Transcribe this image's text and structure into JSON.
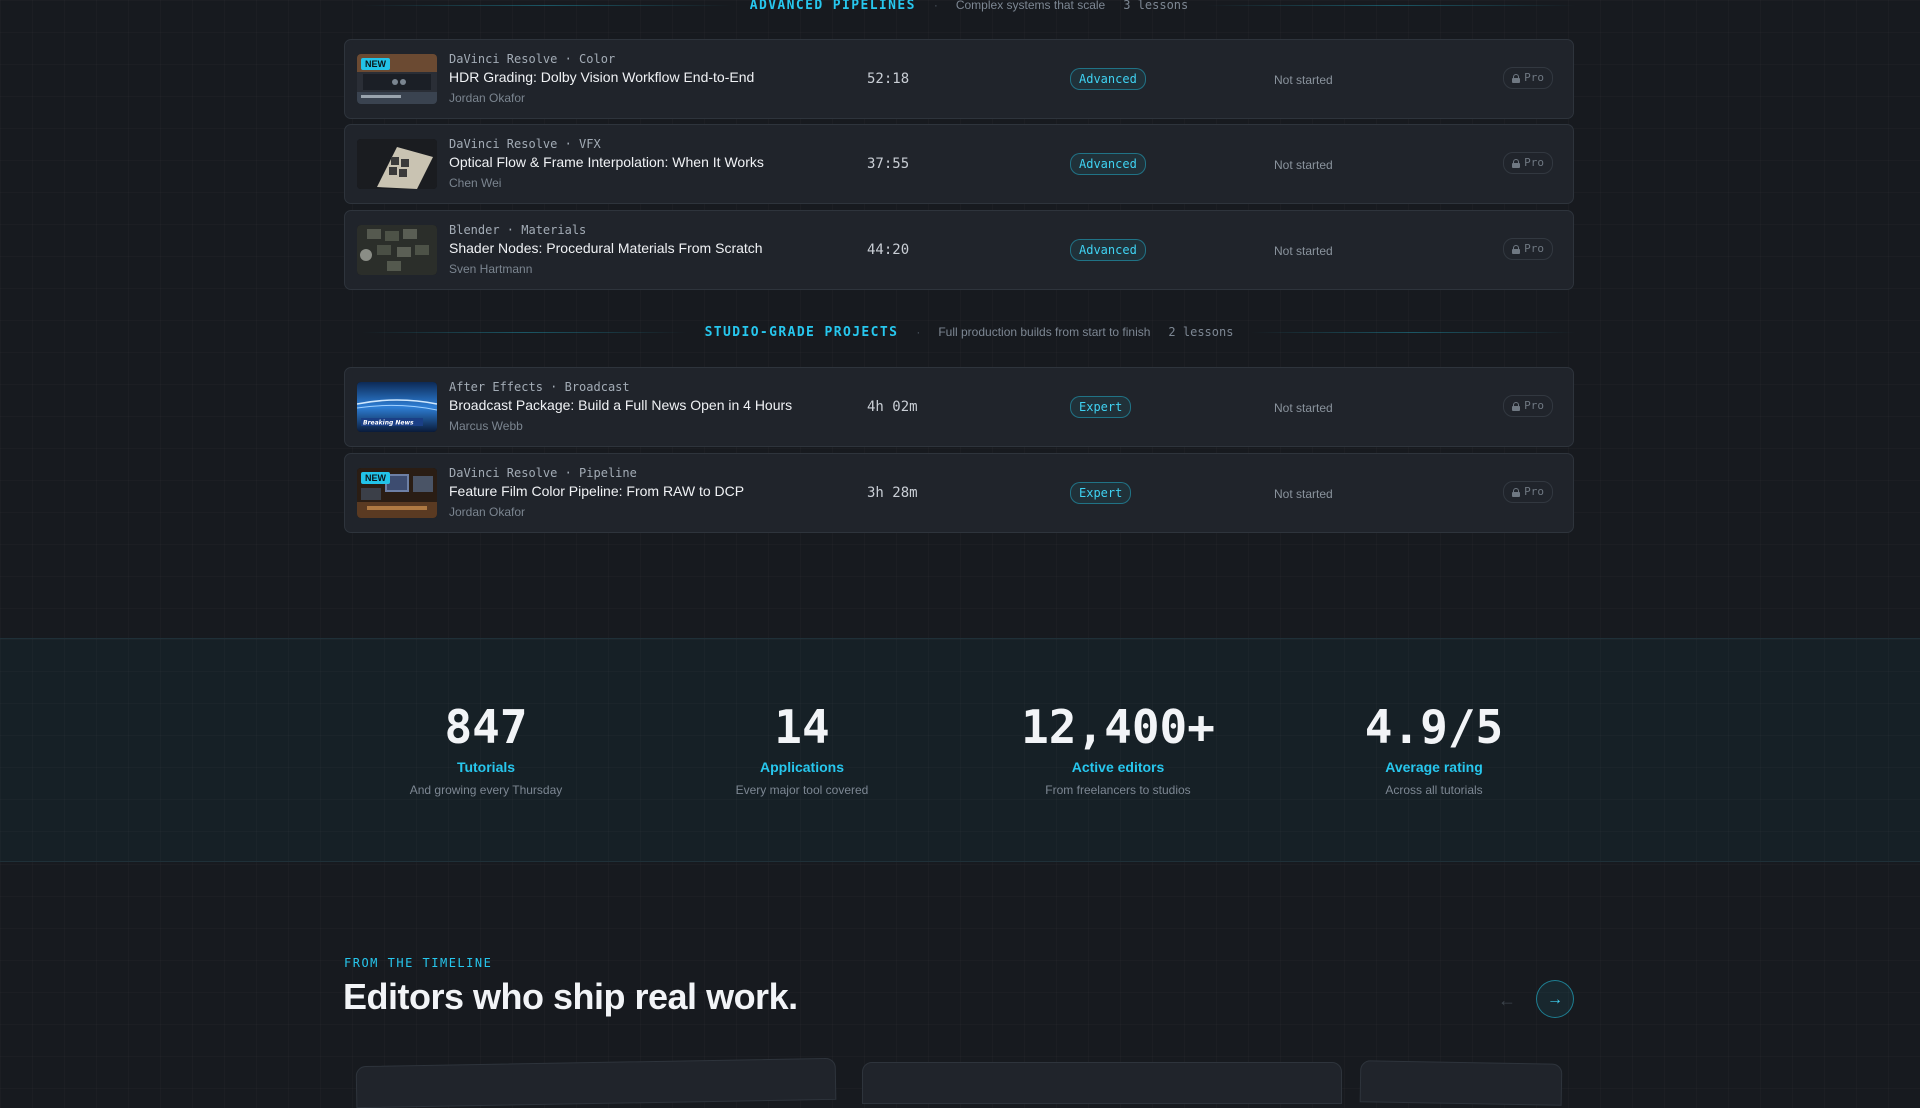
{
  "sections": [
    {
      "title": "ADVANCED PIPELINES",
      "subtitle": "Complex systems that scale",
      "count": "3 lessons"
    },
    {
      "title": "STUDIO-GRADE PROJECTS",
      "subtitle": "Full production builds from start to finish",
      "count": "2 lessons"
    }
  ],
  "separator": "·",
  "lessons": [
    {
      "meta": "DaVinci Resolve · Color",
      "title": "HDR Grading: Dolby Vision Workflow End-to-End",
      "author": "Jordan Okafor",
      "duration": "52:18",
      "level": "Advanced",
      "status": "Not started",
      "access": "Pro",
      "badge": "NEW"
    },
    {
      "meta": "DaVinci Resolve · VFX",
      "title": "Optical Flow & Frame Interpolation: When It Works",
      "author": "Chen Wei",
      "duration": "37:55",
      "level": "Advanced",
      "status": "Not started",
      "access": "Pro"
    },
    {
      "meta": "Blender · Materials",
      "title": "Shader Nodes: Procedural Materials From Scratch",
      "author": "Sven Hartmann",
      "duration": "44:20",
      "level": "Advanced",
      "status": "Not started",
      "access": "Pro"
    },
    {
      "meta": "After Effects · Broadcast",
      "title": "Broadcast Package: Build a Full News Open in 4 Hours",
      "author": "Marcus Webb",
      "duration": "4h 02m",
      "level": "Expert",
      "status": "Not started",
      "access": "Pro",
      "thumb_text": "Breaking News"
    },
    {
      "meta": "DaVinci Resolve · Pipeline",
      "title": "Feature Film Color Pipeline: From RAW to DCP",
      "author": "Jordan Okafor",
      "duration": "3h 28m",
      "level": "Expert",
      "status": "Not started",
      "access": "Pro",
      "badge": "NEW"
    }
  ],
  "stats": [
    {
      "value": "847",
      "label": "Tutorials",
      "sub": "And growing every Thursday"
    },
    {
      "value": "14",
      "label": "Applications",
      "sub": "Every major tool covered"
    },
    {
      "value": "12,400+",
      "label": "Active editors",
      "sub": "From freelancers to studios"
    },
    {
      "value": "4.9/5",
      "label": "Average rating",
      "sub": "Across all tutorials"
    }
  ],
  "testimonials": {
    "eyebrow": "FROM THE TIMELINE",
    "heading": "Editors who ship real work.",
    "prev_icon": "←",
    "next_icon": "→"
  },
  "colors": {
    "accent": "#27c7ee",
    "background": "#171a1f",
    "card": "#20242b"
  }
}
